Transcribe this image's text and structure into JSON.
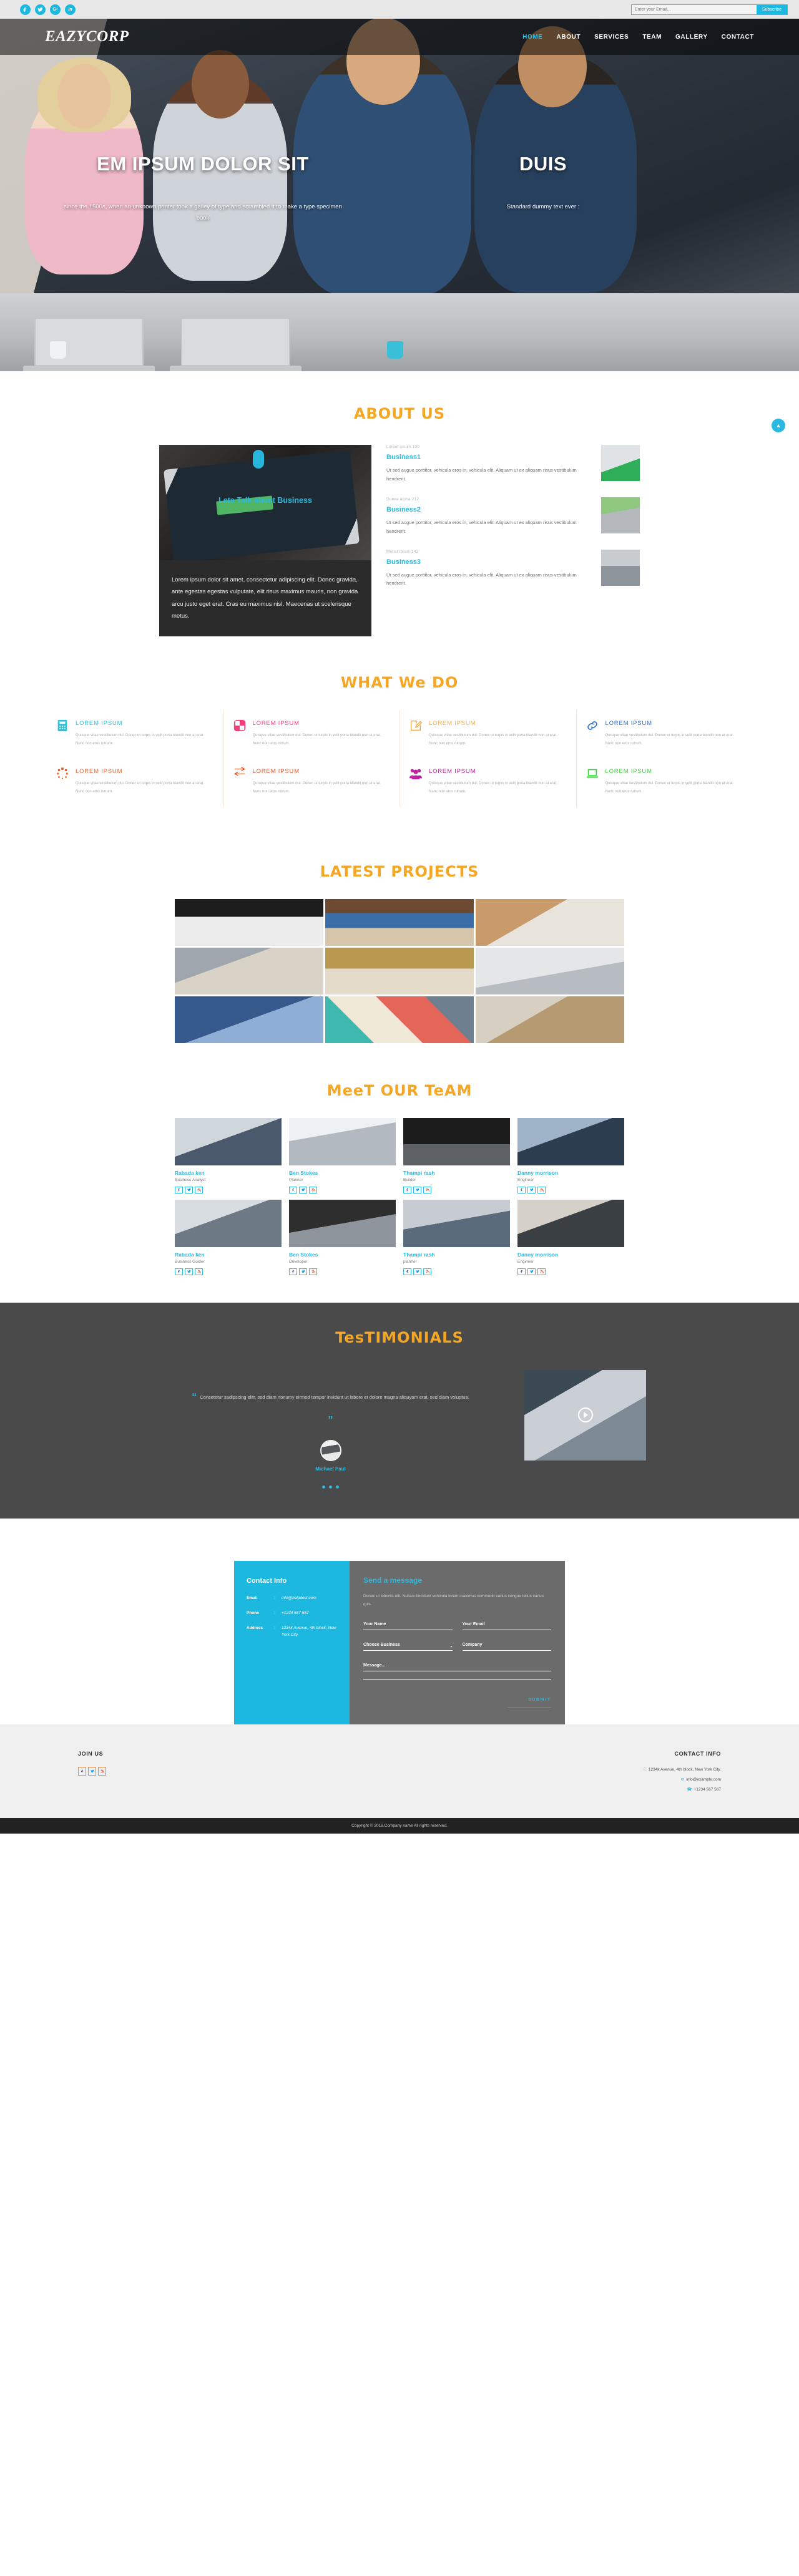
{
  "topbar": {
    "social": [
      {
        "name": "facebook-icon",
        "glyph": "f"
      },
      {
        "name": "twitter-icon",
        "glyph": "t"
      },
      {
        "name": "google-plus-icon",
        "glyph": "G+"
      },
      {
        "name": "linkedin-icon",
        "glyph": "in"
      }
    ],
    "email_placeholder": "Enter your Email...",
    "email_value": "",
    "subscribe_label": "Subscribe"
  },
  "header": {
    "logo": "EAZYCORP",
    "nav": [
      {
        "label": "HOME",
        "active": true
      },
      {
        "label": "ABOUT",
        "active": false
      },
      {
        "label": "SERVICES",
        "active": false
      },
      {
        "label": "TEAM",
        "active": false
      },
      {
        "label": "GALLERY",
        "active": false
      },
      {
        "label": "CONTACT",
        "active": false
      }
    ]
  },
  "hero": {
    "slide_left": {
      "title": "EM IPSUM DOLOR SIT",
      "subtitle": "since the 1500s, when an unknown printer took a galley of type and scrambled it to make a type specimen book"
    },
    "slide_right": {
      "title": "DUIS",
      "subtitle": "Standard dummy text ever :"
    }
  },
  "about": {
    "heading": "ABOUT US",
    "image_caption": "Lets Talk about Business",
    "body": "Lorem ipsum dolor sit amet, consectetur adipiscing elit. Donec gravida, ante egestas egestas vulputate, elit risus maximus mauris, non gravida arcu justo eget erat. Cras eu maximus nisl. Maecenas ut scelerisque metus.",
    "scroll_top_glyph": "▲",
    "items": [
      {
        "kicker": "Lorem ipsum 109",
        "title": "Business1",
        "desc": "Ut sed augue porttitor, vehicula eros in, vehicula elit. Aliquam ut ex aliquam risus vestibulum hendrerit."
      },
      {
        "kicker": "Dunke alpha 212",
        "title": "Business2",
        "desc": "Ut sed augue porttitor, vehicula eros in, vehicula elit. Aliquam ut ex aliquam risus vestibulum hendrerit."
      },
      {
        "kicker": "Monst ibram 143",
        "title": "Business3",
        "desc": "Ut sed augue porttitor, vehicula eros in, vehicula elit. Aliquam ut ex aliquam risus vestibulum hendrerit."
      }
    ]
  },
  "what_we_do": {
    "heading": "WHAT We DO",
    "body": "Quisque vitae vestibulum dui. Donec ut turpis in velit porta blandit non at erat. Nunc non eros rutrum.",
    "cells": [
      {
        "label": "LOREM IPSUM",
        "color": "#2fc0d8",
        "icon": "calculator-icon"
      },
      {
        "label": "LOREM IPSUM",
        "color": "#f0407a",
        "icon": "grid-squares-icon"
      },
      {
        "label": "LOREM IPSUM",
        "color": "#f0ad4e",
        "icon": "pencil-edit-icon"
      },
      {
        "label": "LOREM IPSUM",
        "color": "#2f6fd8",
        "icon": "link-chain-icon"
      },
      {
        "label": "LOREM IPSUM",
        "color": "#f2622b",
        "icon": "loading-spinner-icon"
      },
      {
        "label": "LOREM IPSUM",
        "color": "#e8542a",
        "icon": "exchange-arrows-icon"
      },
      {
        "label": "LOREM IPSUM",
        "color": "#c0219e",
        "icon": "users-group-icon"
      },
      {
        "label": "LOREM IPSUM",
        "color": "#3ad63a",
        "icon": "laptop-icon"
      }
    ]
  },
  "projects": {
    "heading": "LATEST PROJECTS",
    "items": [
      {
        "alt": "clock-and-notebook-on-desk"
      },
      {
        "alt": "hands-writing-in-book"
      },
      {
        "alt": "desk-with-phone-and-markers"
      },
      {
        "alt": "person-using-tablet"
      },
      {
        "alt": "open-box-on-wooden-table"
      },
      {
        "alt": "white-desk-with-monitor"
      },
      {
        "alt": "laptop-blue-background"
      },
      {
        "alt": "colorful-geometric-pattern"
      },
      {
        "alt": "desk-flatlay-with-devices"
      }
    ]
  },
  "team": {
    "heading": "MeeT OUR TeAM",
    "social": [
      "facebook-icon",
      "twitter-icon",
      "rss-icon"
    ],
    "members": [
      {
        "name": "Rabada ken",
        "role": "Business Analyst"
      },
      {
        "name": "Ben Stokes",
        "role": "Planner"
      },
      {
        "name": "Thampi rash",
        "role": "Builder"
      },
      {
        "name": "Danny morrison",
        "role": "Engineer"
      },
      {
        "name": "Rabada ken",
        "role": "Business Guider"
      },
      {
        "name": "Ben Stokes",
        "role": "Developer"
      },
      {
        "name": "Thampi rash",
        "role": "planner"
      },
      {
        "name": "Danny morrison",
        "role": "Engineer"
      }
    ]
  },
  "testimonials": {
    "heading": "TesTIMONIALS",
    "quote_open": "“",
    "quote_close": "”",
    "quote": "Consetetur sadipscing elitr, sed diam nonumy eirmod tempor invidunt ut labore et dolore magna aliquyam erat, sed diam voluptua.",
    "author": "Michael Paul",
    "dots": 3,
    "video_alt": "hands-typing-on-laptop"
  },
  "contact": {
    "info_title": "Contact Info",
    "rows": [
      {
        "key": "Email",
        "sep": ":",
        "value": "info@helpdest.com"
      },
      {
        "key": "Phone",
        "sep": ":",
        "value": "+1234 567 567"
      },
      {
        "key": "Address",
        "sep": ":",
        "value": "1234k Avenue, 4th block, New York City."
      }
    ],
    "form_title": "Send a message",
    "form_desc": "Donec ut lobortis elit. Nullam tincidunt vehicula lorem maximus commodo varius congue tellus varius quis.",
    "fields": {
      "name": "Your Name",
      "email": "Your Email",
      "business": "Choose Business",
      "business_arrow": "▾",
      "company": "Company",
      "message": "Message..."
    },
    "submit_label": "SUBMIT"
  },
  "footer": {
    "join_title": "JOIN US",
    "join_social": [
      "facebook-icon",
      "twitter-icon",
      "rss-icon"
    ],
    "contact_title": "CONTACT INFO",
    "contact_lines": [
      {
        "icon": "location-pin-icon",
        "glyph": "☉",
        "text": "1234k Avenue, 4th block, New York City."
      },
      {
        "icon": "envelope-icon",
        "glyph": "✉",
        "text": "info@example.com"
      },
      {
        "icon": "phone-icon",
        "glyph": "☎",
        "text": "+1234 567 567"
      }
    ],
    "copyright": "Copyright © 2018.Company name All rights reserved."
  }
}
